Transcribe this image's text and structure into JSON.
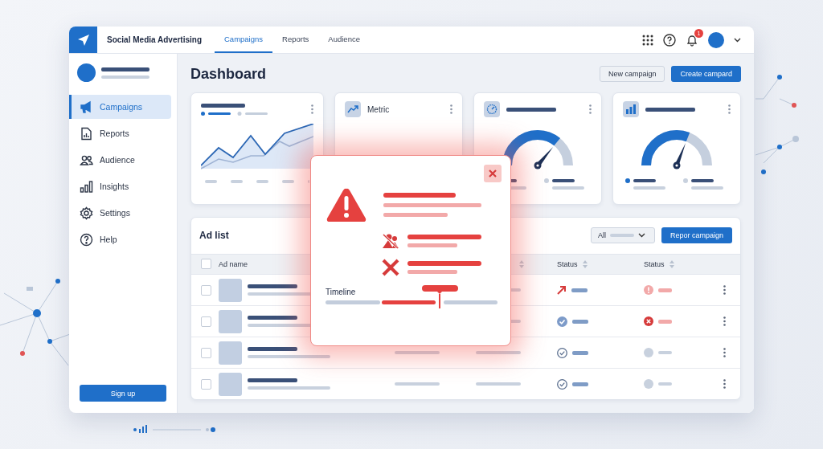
{
  "app": {
    "title": "Social Media Advertising",
    "notification_count": "1"
  },
  "nav_tabs": [
    {
      "label": "Campaigns",
      "selected": true
    },
    {
      "label": "Reports",
      "selected": false
    },
    {
      "label": "Audience",
      "selected": false
    }
  ],
  "sidebar": {
    "items": [
      {
        "label": "Campaigns",
        "selected": true
      },
      {
        "label": "Reports",
        "selected": false
      },
      {
        "label": "Audience",
        "selected": false
      },
      {
        "label": "Insights",
        "selected": false
      },
      {
        "label": "Settings",
        "selected": false
      },
      {
        "label": "Help",
        "selected": false
      }
    ],
    "button": "Sign up"
  },
  "page": {
    "title": "Dashboard",
    "buttons": [
      {
        "label": "New campaign",
        "kind": "secondary"
      },
      {
        "label": "Create campard",
        "kind": "primary"
      }
    ]
  },
  "cards": [
    {
      "kind": "line"
    },
    {
      "kind": "metric",
      "title": "Metric"
    },
    {
      "kind": "gauge"
    },
    {
      "kind": "gauge"
    }
  ],
  "ad_list": {
    "title": "Ad list",
    "filter": "All",
    "button": "Repor campaign",
    "all_checked": false,
    "columns": [
      "Ad name",
      "Status",
      "Status"
    ],
    "rows": [
      {
        "checked": false,
        "statuses": [
          {
            "kind": "trend"
          },
          {
            "kind": "warning"
          }
        ]
      },
      {
        "checked": false,
        "statuses": [
          {
            "kind": "done"
          },
          {
            "kind": "error"
          }
        ]
      },
      {
        "checked": false,
        "statuses": [
          {
            "kind": "check"
          },
          {
            "kind": "idle"
          }
        ]
      },
      {
        "checked": false,
        "statuses": [
          {
            "kind": "check"
          },
          {
            "kind": "idle"
          }
        ]
      }
    ]
  },
  "alert": {
    "timeline_label": "Timeline"
  }
}
